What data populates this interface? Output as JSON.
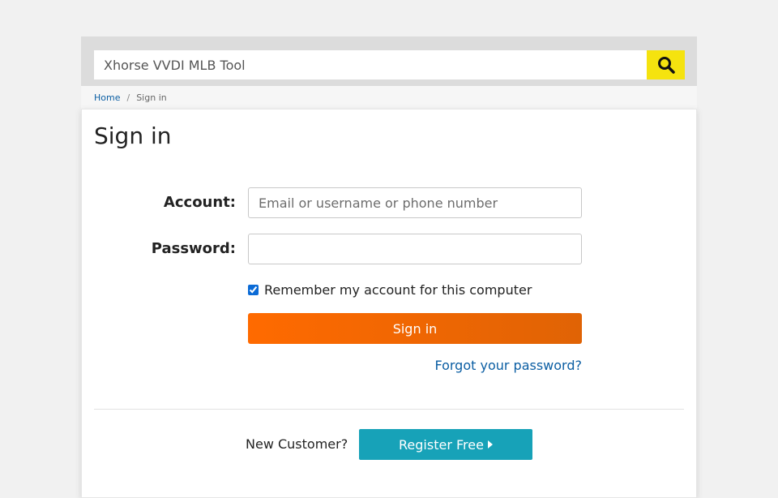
{
  "search": {
    "value": "Xhorse VVDI MLB Tool",
    "button_icon": "search-icon"
  },
  "breadcrumb": {
    "home": "Home",
    "separator": "/",
    "current": "Sign in"
  },
  "page": {
    "title": "Sign in"
  },
  "form": {
    "account_label": "Account:",
    "account_placeholder": "Email or username or phone number",
    "account_value": "",
    "password_label": "Password:",
    "password_value": "",
    "remember_label": "Remember my account for this computer",
    "remember_checked": true,
    "submit_label": "Sign in",
    "forgot_label": "Forgot your password?"
  },
  "register": {
    "prompt": "New Customer?",
    "button_label": "Register Free"
  },
  "colors": {
    "search_button": "#f5e30f",
    "signin_button": "#ff6a00",
    "register_button": "#17a2b8",
    "link": "#0b5ea3"
  }
}
